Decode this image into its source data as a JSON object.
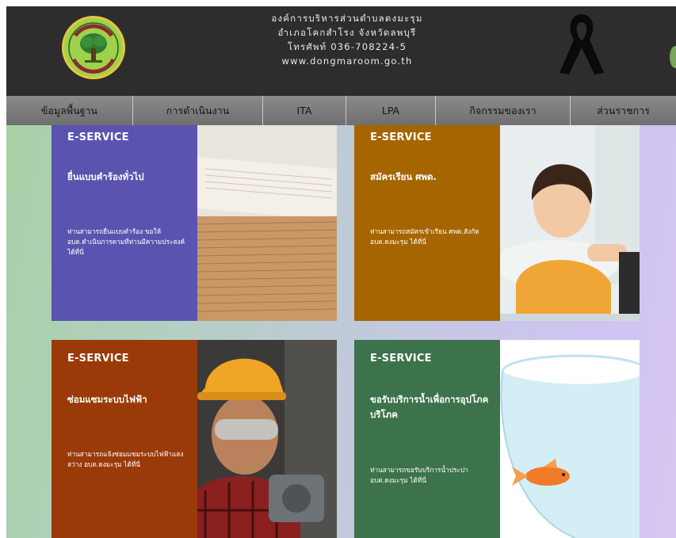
{
  "header": {
    "line1": "องค์การบริหารส่วนตำบลดงมะรุม",
    "line2": "อำเภอโคกสำโรง  จังหวัดลพบุรี",
    "line3": "โทรศัพท์ 036-708224-5",
    "line4": "www.dongmaroom.go.th"
  },
  "nav": [
    {
      "label": "ข้อมูลพื้นฐาน"
    },
    {
      "label": "การดำเนินงาน"
    },
    {
      "label": "ITA"
    },
    {
      "label": "LPA"
    },
    {
      "label": "กิจกรรมของเรา"
    },
    {
      "label": "ส่วนราชการ"
    }
  ],
  "colors": {
    "header_bg": "#2d2d2d",
    "card_purple": "#5a54b0",
    "card_orange": "#a56500",
    "card_rust": "#9a3a08",
    "card_green": "#3d734b"
  },
  "cards": [
    {
      "eyebrow": "E-SERVICE",
      "title": "ยื่นแบบคำร้องทั่วไป",
      "description": "ท่านสามารถยื่นแบบคำร้อง ขอให้ อบต.ดำเนินการตามที่ท่านมีความประสงค์ ได้ที่นี่",
      "image": "paper-stack"
    },
    {
      "eyebrow": "E-SERVICE",
      "title": "สมัครเรียน ศพด.",
      "description": "ท่านสามารถสมัครเข้าเรียน ศพด.สังกัด อบต.ดงมะรุม ได้ที่นี่",
      "image": "child-writing"
    },
    {
      "eyebrow": "E-SERVICE",
      "title": "ซ่อมแซมระบบไฟฟ้า",
      "description": "ท่านสามารถแจ้งซ่อมแซมระบบไฟฟ้าแสงสว่าง อบต.ดงมะรุม ได้ที่นี่",
      "image": "engineer-helmet"
    },
    {
      "eyebrow": "E-SERVICE",
      "title": "ขอรับบริการน้ำเพื่อการอุปโภคบริโภค",
      "description": "ท่านสามารถขอรับบริการน้ำประปา อบต.ดงมะรุม ได้ที่นี่",
      "image": "goldfish-bowl"
    }
  ]
}
